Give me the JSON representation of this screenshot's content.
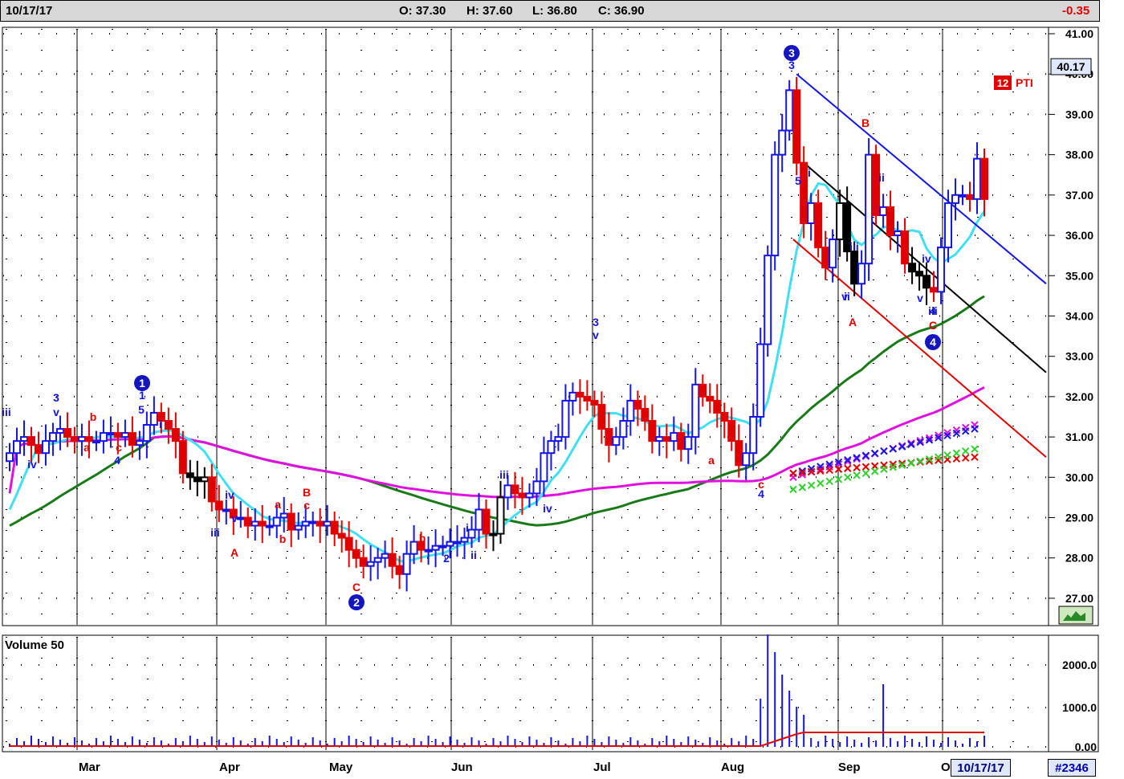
{
  "header": {
    "date": "10/17/17",
    "open": "O: 37.30",
    "high": "H: 37.60",
    "low": "L: 36.80",
    "close": "C: 36.90",
    "change": "-0.35"
  },
  "price_panel": {
    "last_price": "40.17",
    "indicator_num": "12",
    "indicator_label": "PTI"
  },
  "volume_panel": {
    "title": "Volume 50"
  },
  "footer": {
    "months": [
      "Mar",
      "Apr",
      "May",
      "Jun",
      "Jul",
      "Aug",
      "Sep",
      "O"
    ],
    "date_box": "10/17/17",
    "count_box": "#2346"
  },
  "colors": {
    "up": "#1515e8",
    "down": "#e00000",
    "neutral": "#000000",
    "ma_fast": "#40e0f0",
    "ma_mid": "#1a7a1a",
    "ma_slow": "#e010e0",
    "channel_blue": "#1515e8",
    "channel_black": "#000000",
    "channel_red": "#e00000"
  },
  "chart_data": {
    "type": "candlestick",
    "y_axis_ticks": [
      "41.00",
      "40.00",
      "39.00",
      "38.00",
      "37.00",
      "36.00",
      "35.00",
      "34.00",
      "33.00",
      "32.00",
      "31.00",
      "30.00",
      "29.00",
      "28.00",
      "27.00"
    ],
    "ylim": [
      26.7,
      41.0
    ],
    "volume_axis_ticks": [
      "2000.0",
      "1000.0",
      "0.00"
    ],
    "x_range_label": "Mar - Oct 2017",
    "closes": [
      30.6,
      30.9,
      31.0,
      30.8,
      30.6,
      30.9,
      31.1,
      31.2,
      31.0,
      30.9,
      31.0,
      30.9,
      30.9,
      31.1,
      31.1,
      31.0,
      31.1,
      30.8,
      30.9,
      31.3,
      31.6,
      31.4,
      31.2,
      30.9,
      30.1,
      30.0,
      29.9,
      30.0,
      29.4,
      29.2,
      29.2,
      29.0,
      29.0,
      28.8,
      28.9,
      28.8,
      28.8,
      29.0,
      29.1,
      28.7,
      28.8,
      28.9,
      28.9,
      28.8,
      28.9,
      28.6,
      28.5,
      28.2,
      28.0,
      27.8,
      27.9,
      28.0,
      28.1,
      27.8,
      27.6,
      28.1,
      28.4,
      28.2,
      28.2,
      28.3,
      28.3,
      28.4,
      28.4,
      28.5,
      28.7,
      29.2,
      28.6,
      28.6,
      29.5,
      29.8,
      29.6,
      29.5,
      29.6,
      29.9,
      30.6,
      30.9,
      31.0,
      31.9,
      32.1,
      32.0,
      31.9,
      31.8,
      31.2,
      30.8,
      31.0,
      31.4,
      31.9,
      31.7,
      31.4,
      30.9,
      31.0,
      30.9,
      31.1,
      30.7,
      31.0,
      32.3,
      32.0,
      31.9,
      31.6,
      31.4,
      30.9,
      30.3,
      30.6,
      31.5,
      33.3,
      35.5,
      38.0,
      38.6,
      39.6,
      37.8,
      36.3,
      36.8,
      35.7,
      35.2,
      35.9,
      36.8,
      35.6,
      34.8,
      35.3,
      38.0,
      36.5,
      36.7,
      36.0,
      36.1,
      35.3,
      35.1,
      35.0,
      34.7,
      34.6,
      35.7,
      36.8,
      37.0,
      37.0,
      36.9,
      37.9,
      36.9
    ],
    "annotations": {
      "blue": [
        "iii",
        "iv",
        "3",
        "v",
        "4",
        "1",
        "5",
        "i",
        "iv",
        "iii",
        "v",
        "2",
        "i",
        "ii",
        "iii",
        "iv",
        "3",
        "v",
        "4",
        "3",
        "5",
        "i",
        "ii",
        "iii",
        "v",
        "ii",
        "iv",
        "iii",
        "v",
        "4"
      ],
      "red": [
        "b",
        "a",
        "c",
        "A",
        "a",
        "B",
        "c",
        "b",
        "C",
        "b",
        "a",
        "B",
        "A",
        "C",
        "c"
      ],
      "circled_blue": [
        "1",
        "2",
        "3",
        "4"
      ]
    },
    "moving_averages": [
      "fast (cyan)",
      "medium (green)",
      "slow (magenta)"
    ]
  }
}
